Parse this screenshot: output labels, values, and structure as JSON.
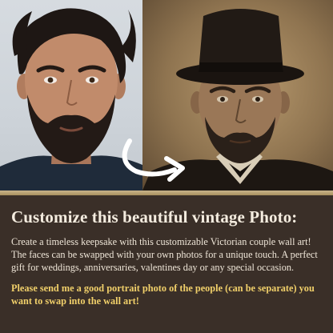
{
  "listing": {
    "title": "Customize this beautiful vintage Photo:",
    "description": "Create a timeless keepsake with this customizable Victorian couple wall art! The faces can be swapped with your own photos for a unique touch. A perfect gift for weddings, anniversaries, valentines day or any special occasion.",
    "call_to_action": "Please send me a good portrait photo of the people (can be separate) you want to swap into the wall art!"
  },
  "colors": {
    "panel_background": "#3a2f28",
    "title_text": "#f4ecdf",
    "body_text": "#efe6d8",
    "highlight_text": "#f1d06a",
    "sepia": "#8f7450"
  },
  "icons": {
    "swap_arrow": "curved-arrow-right-icon"
  }
}
